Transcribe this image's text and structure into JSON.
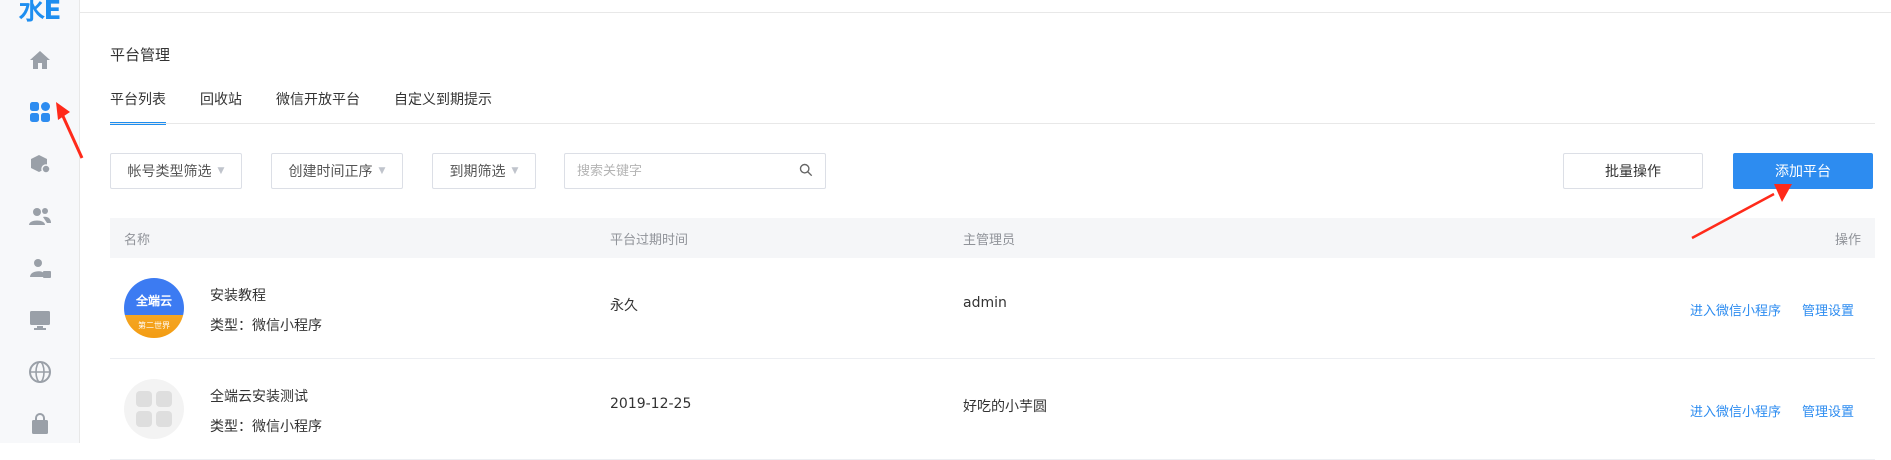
{
  "sidebar": {
    "logo": "水E",
    "icons": [
      "home-icon",
      "apps-icon",
      "box-gear-icon",
      "users-icon",
      "user-lock-icon",
      "monitor-icon",
      "globe-icon",
      "bag-icon"
    ]
  },
  "page": {
    "title": "平台管理",
    "tabs": [
      {
        "label": "平台列表",
        "active": true
      },
      {
        "label": "回收站",
        "active": false
      },
      {
        "label": "微信开放平台",
        "active": false
      },
      {
        "label": "自定义到期提示",
        "active": false
      }
    ]
  },
  "filters": {
    "account_type": "帐号类型筛选",
    "create_time": "创建时间正序",
    "expire": "到期筛选",
    "search_placeholder": "搜索关键字"
  },
  "actions": {
    "batch": "批量操作",
    "add": "添加平台"
  },
  "table": {
    "headers": {
      "name": "名称",
      "expire": "平台过期时间",
      "admin": "主管理员",
      "ops": "操作"
    },
    "rows": [
      {
        "name": "安装教程",
        "type_label": "类型：",
        "type": "微信小程序",
        "expire": "永久",
        "admin": "admin",
        "avatar_text": "全端云",
        "avatar_sub": "第二世界",
        "op_enter": "进入微信小程序",
        "op_manage": "管理设置"
      },
      {
        "name": "全端云安装测试",
        "type_label": "类型：",
        "type": "微信小程序",
        "expire": "2019-12-25",
        "admin": "好吃的小芋圆",
        "op_enter": "进入微信小程序",
        "op_manage": "管理设置"
      }
    ]
  },
  "colors": {
    "accent": "#2d8cf0",
    "annotation_arrow": "#ff2a1a"
  }
}
